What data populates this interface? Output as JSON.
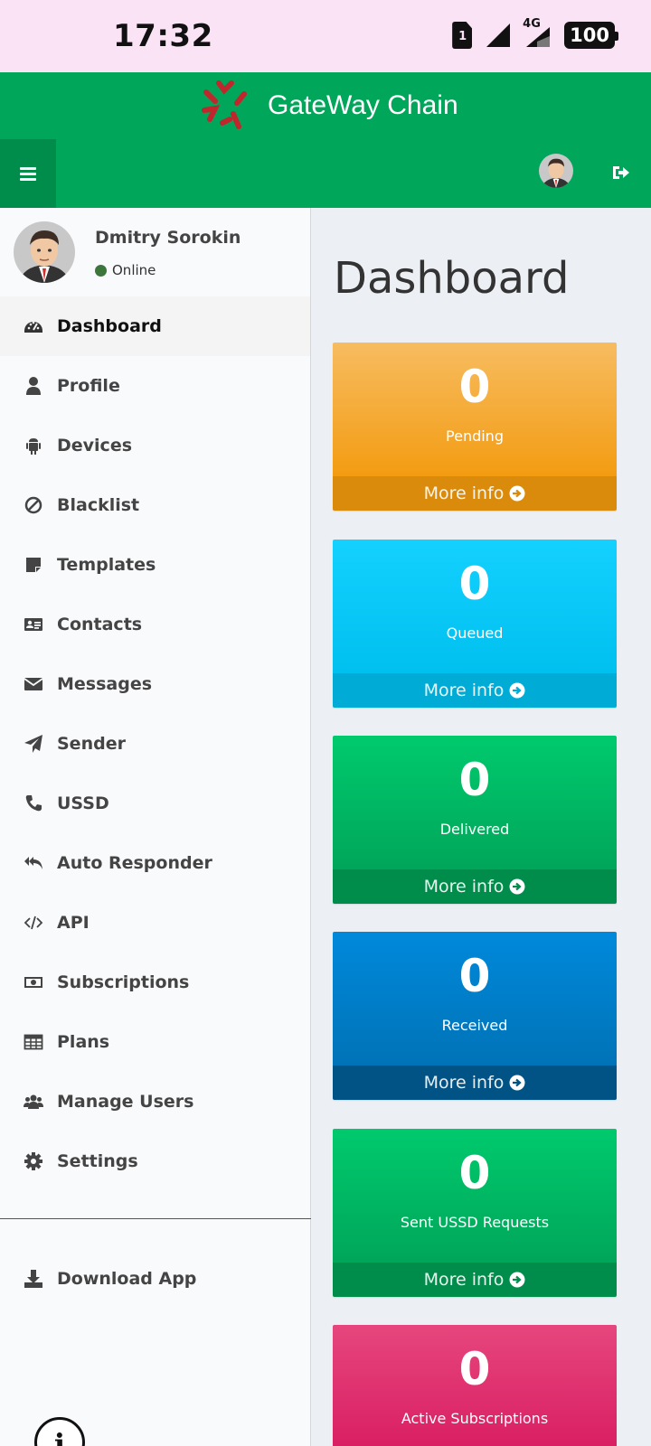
{
  "status_bar": {
    "time": "17:32",
    "network": "4G",
    "battery": "100",
    "sim_number": "1"
  },
  "header": {
    "app_title": "GateWay Chain"
  },
  "user": {
    "name": "Dmitry Sorokin",
    "status": "Online"
  },
  "sidebar": {
    "items": [
      {
        "label": "Dashboard",
        "icon": "tachometer-icon",
        "active": true
      },
      {
        "label": "Profile",
        "icon": "user-icon"
      },
      {
        "label": "Devices",
        "icon": "android-icon"
      },
      {
        "label": "Blacklist",
        "icon": "ban-icon"
      },
      {
        "label": "Templates",
        "icon": "sticky-note-icon"
      },
      {
        "label": "Contacts",
        "icon": "address-card-icon"
      },
      {
        "label": "Messages",
        "icon": "envelope-icon"
      },
      {
        "label": "Sender",
        "icon": "paper-plane-icon"
      },
      {
        "label": "USSD",
        "icon": "phone-icon"
      },
      {
        "label": "Auto Responder",
        "icon": "reply-all-icon"
      },
      {
        "label": "API",
        "icon": "code-icon"
      },
      {
        "label": "Subscriptions",
        "icon": "money-icon"
      },
      {
        "label": "Plans",
        "icon": "table-icon"
      },
      {
        "label": "Manage Users",
        "icon": "users-icon"
      },
      {
        "label": "Settings",
        "icon": "cog-icon"
      }
    ],
    "download_label": "Download App"
  },
  "content": {
    "title": "Dashboard",
    "boxes": [
      {
        "value": "0",
        "label": "Pending",
        "footer": "More info",
        "color": "#f39c12"
      },
      {
        "value": "0",
        "label": "Queued",
        "footer": "More info",
        "color": "#00c0ef"
      },
      {
        "value": "0",
        "label": "Delivered",
        "footer": "More info",
        "color": "#00a65a"
      },
      {
        "value": "0",
        "label": "Received",
        "footer": "More info",
        "color": "#0073b7"
      },
      {
        "value": "0",
        "label": "Sent USSD Requests",
        "footer": "More info",
        "color": "#00a65a"
      },
      {
        "value": "0",
        "label": "Active Subscriptions",
        "color": "#d81b60"
      }
    ]
  },
  "colors": {
    "header": "#00a65a",
    "header_dark": "#008d4c",
    "logo": "#c0272d",
    "status_bar_bg": "#fbe3f6"
  }
}
